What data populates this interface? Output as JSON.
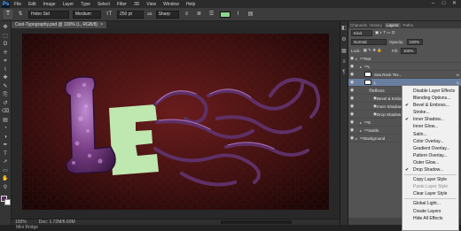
{
  "app": {
    "logo": "Ps"
  },
  "menubar": {
    "items": [
      "File",
      "Edit",
      "Image",
      "Layer",
      "Type",
      "Select",
      "Filter",
      "3D",
      "View",
      "Window",
      "Help"
    ]
  },
  "window_controls": [
    "–",
    "□",
    "✕"
  ],
  "options": {
    "font_family": "Hobo Std",
    "font_style": "Medium",
    "font_size": "250 pt",
    "anti_alias_icon": "aa",
    "anti_alias": "Sharp",
    "text_color": "#8bd58b"
  },
  "toolbar": {
    "tools": [
      "move-tool",
      "marquee-tool",
      "lasso-tool",
      "quick-select-tool",
      "crop-tool",
      "eyedropper-tool",
      "healing-tool",
      "brush-tool",
      "clone-tool",
      "history-brush-tool",
      "eraser-tool",
      "gradient-tool",
      "blur-tool",
      "dodge-tool",
      "pen-tool",
      "type-tool",
      "path-select-tool",
      "shape-tool",
      "hand-tool",
      "zoom-tool"
    ],
    "glyphs": [
      "✥",
      "⬚",
      "ʘ",
      "⁜",
      "⌗",
      "⌇",
      "✚",
      "✎",
      "⎘",
      "↺",
      "⌫",
      "▤",
      "◔",
      "◑",
      "✒",
      "T",
      "➚",
      "▭",
      "✋",
      "⚲"
    ],
    "fg_color": "#5a2a60",
    "bg_color": "#ffffff"
  },
  "document": {
    "tab_title": "Cool-Typography.psd @ 100% (L, RGB/8)",
    "close": "×",
    "zoom": "100%",
    "doc_size": "Doc: 1.72M/6.60M"
  },
  "panel_strip": [
    "◧",
    "⚙",
    "▦",
    "≡",
    "¶"
  ],
  "layers_panel": {
    "tabs": [
      "Channels",
      "History",
      "Layers",
      "Paths"
    ],
    "active_tab": "Layers",
    "filter_label": "Kind",
    "blend_mode": "Normal",
    "opacity_label": "Opacity:",
    "opacity": "100%",
    "lock_label": "Lock:",
    "fill_label": "Fill:",
    "fill": "100%",
    "layers": [
      {
        "name": "Text",
        "kind": "group",
        "indent": 0
      },
      {
        "name": "L",
        "kind": "group",
        "indent": 1
      },
      {
        "name": "Sea Rock Tex...",
        "kind": "layer",
        "indent": 2
      },
      {
        "name": "L",
        "kind": "text",
        "indent": 2,
        "selected": true
      },
      {
        "name": "Effects",
        "kind": "effects",
        "indent": 3
      },
      {
        "name": "Bevel & Emboss",
        "kind": "effect",
        "indent": 4
      },
      {
        "name": "Inner Shadow",
        "kind": "effect",
        "indent": 4
      },
      {
        "name": "Drop Shadow",
        "kind": "effect",
        "indent": 4
      },
      {
        "name": "E",
        "kind": "group",
        "indent": 1
      },
      {
        "name": "Swirls",
        "kind": "group",
        "indent": 1
      },
      {
        "name": "Background",
        "kind": "group",
        "indent": 0
      }
    ]
  },
  "context_menu": {
    "items": [
      {
        "label": "Disable Layer Effects"
      },
      {
        "label": "Blending Options..."
      },
      {
        "label": "Bevel & Emboss...",
        "checked": true
      },
      {
        "label": "Stroke..."
      },
      {
        "label": "Inner Shadow...",
        "checked": true
      },
      {
        "label": "Inner Glow..."
      },
      {
        "label": "Satin..."
      },
      {
        "label": "Color Overlay..."
      },
      {
        "label": "Gradient Overlay..."
      },
      {
        "label": "Pattern Overlay..."
      },
      {
        "label": "Outer Glow..."
      },
      {
        "label": "Drop Shadow...",
        "checked": true
      },
      {
        "separator": true
      },
      {
        "label": "Copy Layer Style"
      },
      {
        "label": "Paste Layer Style",
        "disabled": true
      },
      {
        "label": "Clear Layer Style"
      },
      {
        "separator": true
      },
      {
        "label": "Global Light..."
      },
      {
        "label": "Create Layers"
      },
      {
        "label": "Hide All Effects"
      }
    ]
  },
  "canvas": {
    "bg_color": "#4a1414",
    "letter_L_color": "#7a3f86",
    "letter_E_color": "#bfe7b0",
    "swirl_color": "#5f3066"
  },
  "bottom": {
    "label": "Mini Bridge"
  }
}
